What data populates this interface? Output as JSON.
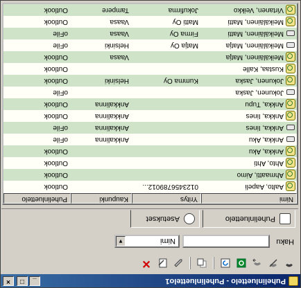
{
  "window": {
    "title": "Puhelinluettelo - Puhelinluettelo1"
  },
  "toolbar": {
    "icons": [
      "phone-icon",
      "no-phone-icon",
      "phone-out-icon",
      "outlook-icon",
      "refresh-icon",
      "copy-icon",
      "edit-icon",
      "edit-page-icon",
      "delete-icon"
    ]
  },
  "search": {
    "label": "Haku",
    "value": "",
    "field_value": "Nimi"
  },
  "tabs": [
    {
      "label": "Puhelinluettelo"
    },
    {
      "label": "Asetukset"
    }
  ],
  "table": {
    "columns": [
      "Nimi",
      "Yritys",
      "Kaupunki",
      "Puhelinluettelo"
    ],
    "rows": [
      {
        "name": "Aalto, Aapeli",
        "company": "0123456789012...",
        "city": "",
        "source": "Outlook",
        "icon": "outlook"
      },
      {
        "name": "Ahmaatti, Aimo",
        "company": "",
        "city": "",
        "source": "Outlook",
        "icon": "outlook"
      },
      {
        "name": "Ahto, Ahti",
        "company": "",
        "city": "",
        "source": "Outlook",
        "icon": "outlook"
      },
      {
        "name": "Ankka, Aku",
        "company": "",
        "city": "",
        "source": "Outlook",
        "icon": "outlook"
      },
      {
        "name": "Ankka, Aku",
        "company": "",
        "city": "Ankkalinna",
        "source": "oFile",
        "icon": "ofile"
      },
      {
        "name": "Ankka, Iines",
        "company": "",
        "city": "Ankkalinna",
        "source": "oFile",
        "icon": "ofile"
      },
      {
        "name": "Ankka, Iines",
        "company": "",
        "city": "Ankkalinna",
        "source": "Outlook",
        "icon": "outlook"
      },
      {
        "name": "Ankka, Tupu",
        "company": "",
        "city": "Ankkalinna",
        "source": "Outlook",
        "icon": "outlook"
      },
      {
        "name": "Jokunen, Jaska",
        "company": "",
        "city": "",
        "source": "oFile",
        "icon": "ofile"
      },
      {
        "name": "Jokunen, Jaska",
        "company": "Kumma Oy",
        "city": "Helsinki",
        "source": "Outlook",
        "icon": "outlook"
      },
      {
        "name": "Kustaa, Kalle",
        "company": "",
        "city": "",
        "source": "Outlook",
        "icon": "outlook"
      },
      {
        "name": "Meikäläinen, Matja",
        "company": "",
        "city": "Vaasa",
        "source": "Outlook",
        "icon": "outlook"
      },
      {
        "name": "Meikäläinen, Matja",
        "company": "Matja Oy",
        "city": "Helsinki",
        "source": "oFile",
        "icon": "ofile"
      },
      {
        "name": "Meikäläinen, Matti",
        "company": "Firma Oy",
        "city": "Vaasa",
        "source": "oFile",
        "icon": "ofile"
      },
      {
        "name": "Meikäläinen, Matti",
        "company": "Matti Oy",
        "city": "Vaasa",
        "source": "Outlook",
        "icon": "outlook"
      },
      {
        "name": "Virtanen, Veikko",
        "company": "Jokufirma",
        "city": "Tampere",
        "source": "Outlook",
        "icon": "outlook"
      }
    ]
  }
}
